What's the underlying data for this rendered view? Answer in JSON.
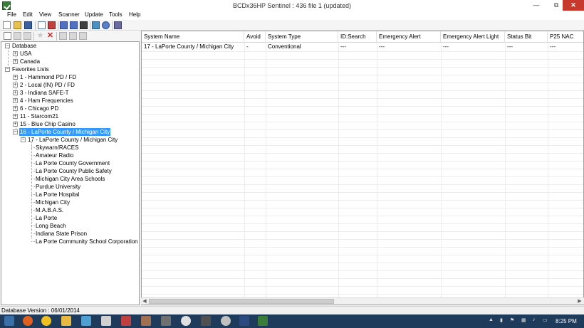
{
  "window": {
    "title": "BCDx36HP Sentinel : 436 file 1 (updated)",
    "minimize_glyph": "—",
    "maximize_glyph": "⧉",
    "close_glyph": "✕"
  },
  "menu": [
    "File",
    "Edit",
    "View",
    "Scanner",
    "Update",
    "Tools",
    "Help"
  ],
  "tree": {
    "database_label": "Database",
    "database_children": [
      "USA",
      "Canada"
    ],
    "favorites_label": "Favorites Lists",
    "favorites": [
      "1 - Hammond PD / FD",
      "2 - Local (IN) PD / FD",
      "3 - Indiana SAFE-T",
      "4 - Ham Frequencies",
      "6 - Chicago PD",
      "11 - Starcom21",
      "15 - Blue Chip Casino",
      "16 - LaPorte County / Michigan City"
    ],
    "system_label": "17 - LaPorte County / Michigan City",
    "departments": [
      "Skywarn/RACES",
      "Amateur Radio",
      "La Porte County Government",
      "La Porte County Public Safety",
      "Michigan City Area Schools",
      "Purdue University",
      "La Porte Hospital",
      "Michigan City",
      "M.A.B.A.S.",
      "La Porte",
      "Long Beach",
      "Indiana State Prison",
      "La Porte Community School Corporation"
    ]
  },
  "grid": {
    "columns": [
      "System Name",
      "Avoid",
      "System Type",
      "ID:Search",
      "Emergency Alert",
      "Emergency Alert Light",
      "Status Bit",
      "P25 NAC"
    ],
    "rows": [
      [
        "17 - LaPorte County / Michigan City",
        "-",
        "Conventional",
        "---",
        "---",
        "---",
        "---",
        "---"
      ]
    ]
  },
  "statusbar": {
    "text": "Database Version : 06/01/2014"
  },
  "taskbar": {
    "clock": "8:25 PM"
  },
  "colors": {
    "selection": "#3399ff",
    "taskbar": "#1f3b5c",
    "close_button": "#c7392d"
  }
}
